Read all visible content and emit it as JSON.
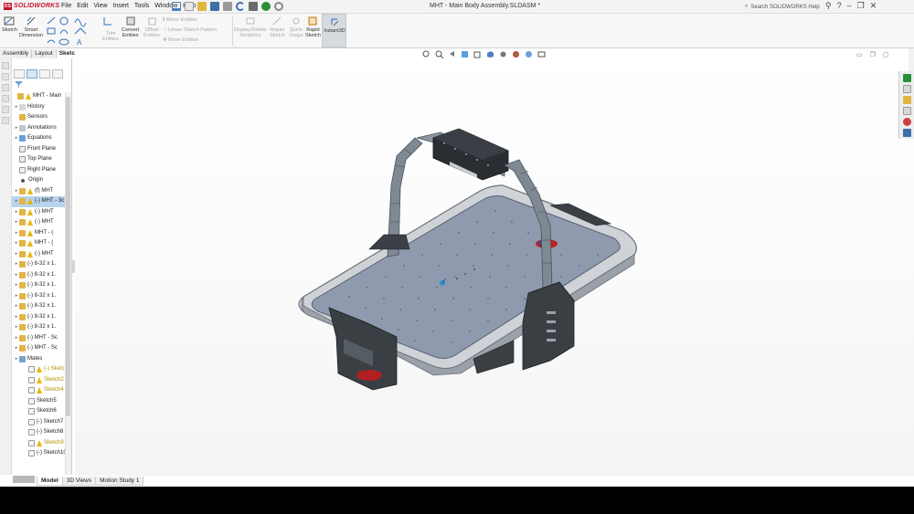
{
  "app": {
    "logo_text": "SOLIDWORKS",
    "menu": [
      "File",
      "Edit",
      "View",
      "Insert",
      "Tools",
      "Window",
      "Help"
    ],
    "document_title": "MHT - Main Body Assembly.SLDASM *",
    "search_placeholder": "Search SOLIDWORKS Help"
  },
  "commands": {
    "sketch": "Sketch",
    "smart_dimension_1": "Smart",
    "smart_dimension_2": "Dimension",
    "trim_1": "Trim",
    "trim_2": "Entities",
    "convert_1": "Convert",
    "convert_2": "Entities",
    "offset_1": "Offset",
    "offset_2": "Entities",
    "mirror": "Mirror Entities",
    "linear_pattern": "Linear Sketch Pattern",
    "move": "Move Entities",
    "display_delete_1": "Display/Delete",
    "display_delete_2": "Relations",
    "repair_1": "Repair",
    "repair_2": "Sketch",
    "quick_snaps_1": "Quick",
    "quick_snaps_2": "Snaps",
    "rapid_1": "Rapid",
    "rapid_2": "Sketch",
    "instant3d": "Instant3D"
  },
  "command_tabs": [
    "Assembly",
    "Layout",
    "Sketch"
  ],
  "tree": {
    "root": "MHT - Main",
    "items": [
      {
        "label": "History",
        "icon": "history-icon"
      },
      {
        "label": "Sensors",
        "icon": "sensors-icon"
      },
      {
        "label": "Annotations",
        "icon": "annotations-icon"
      },
      {
        "label": "Equations",
        "icon": "equations-icon"
      },
      {
        "label": "Front Plane",
        "icon": "plane-icon"
      },
      {
        "label": "Top Plane",
        "icon": "plane-icon"
      },
      {
        "label": "Right Plane",
        "icon": "plane-icon"
      },
      {
        "label": "Origin",
        "icon": "origin-icon"
      },
      {
        "label": "(f) MHT",
        "icon": "part-icon"
      },
      {
        "label": "(-) MHT - 3c",
        "icon": "part-icon"
      },
      {
        "label": "(-) MHT",
        "icon": "part-icon"
      },
      {
        "label": "(-) MHT",
        "icon": "part-icon"
      },
      {
        "label": "MHT - (",
        "icon": "part-icon"
      },
      {
        "label": "MHT - (",
        "icon": "part-icon"
      },
      {
        "label": "(-) MHT",
        "icon": "part-icon"
      },
      {
        "label": "(-) 8-32 x 1.",
        "icon": "part-icon"
      },
      {
        "label": "(-) 8-32 x 1.",
        "icon": "part-icon"
      },
      {
        "label": "(-) 8-32 x 1.",
        "icon": "part-icon"
      },
      {
        "label": "(-) 8-32 x 1.",
        "icon": "part-icon"
      },
      {
        "label": "(-) 8-32 x 1.",
        "icon": "part-icon"
      },
      {
        "label": "(-) 8-32 x 1.",
        "icon": "part-icon"
      },
      {
        "label": "(-) 8-32 x 1.",
        "icon": "part-icon"
      },
      {
        "label": "(-) MHT - Sc",
        "icon": "part-icon"
      },
      {
        "label": "(-) MHT - Sc",
        "icon": "part-icon"
      },
      {
        "label": "Mates",
        "icon": "mates-icon"
      },
      {
        "label": "(-) Sketch",
        "icon": "sketch-icon"
      },
      {
        "label": "Sketch2",
        "icon": "sketch-icon"
      },
      {
        "label": "Sketch4",
        "icon": "sketch-icon"
      },
      {
        "label": "Sketch5",
        "icon": "sketch-icon"
      },
      {
        "label": "Sketch6",
        "icon": "sketch-icon"
      },
      {
        "label": "(-) Sketch7",
        "icon": "sketch-icon"
      },
      {
        "label": "(-) Sketch8",
        "icon": "sketch-icon"
      },
      {
        "label": "Sketch9",
        "icon": "sketch-icon"
      },
      {
        "label": "(-) Sketch10",
        "icon": "sketch-icon"
      }
    ]
  },
  "bottom_tabs": [
    "Model",
    "3D Views",
    "Motion Study 1"
  ],
  "colors": {
    "brand": "#c8102e",
    "selection": "#b9d3ee",
    "warning": "#e6b800",
    "plate": "#8d97ab",
    "frame": "#5f6b78",
    "dark_part": "#2f3338"
  }
}
